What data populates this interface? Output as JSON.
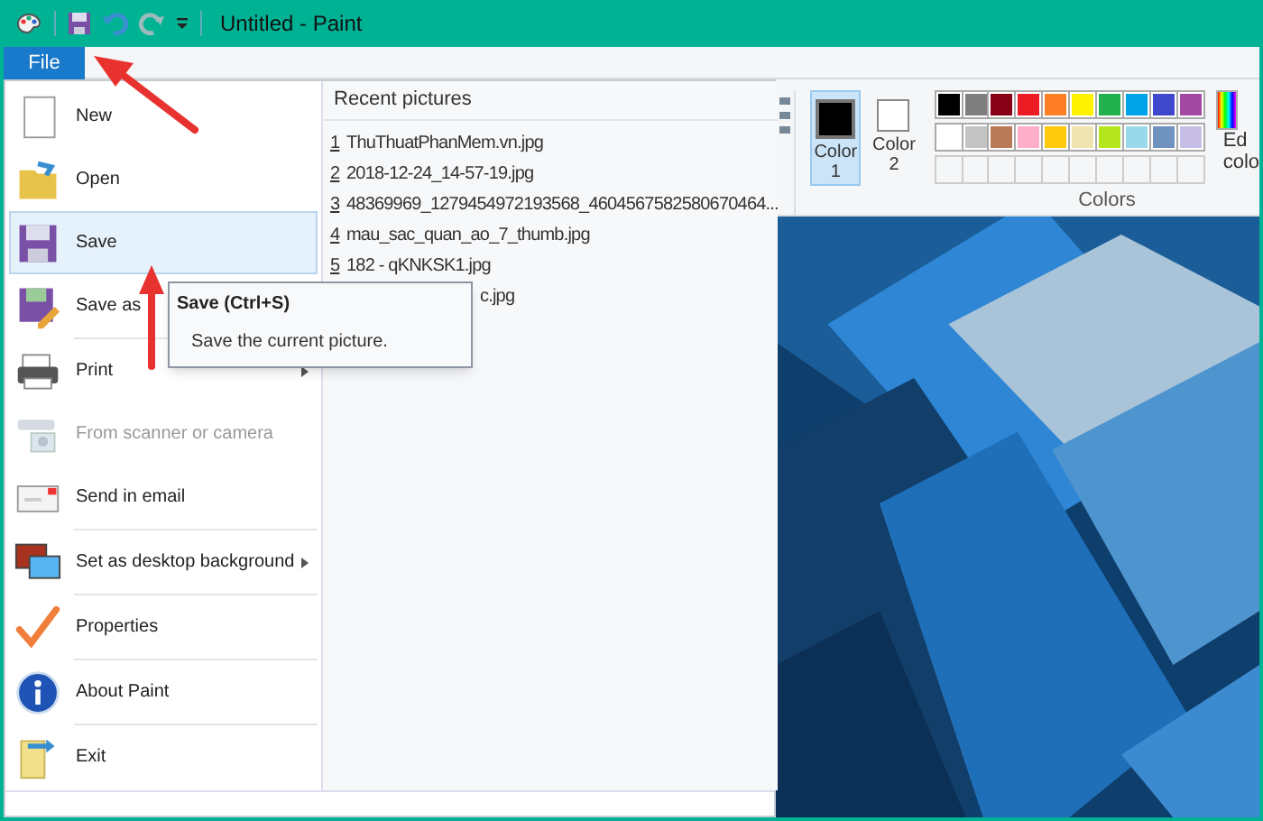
{
  "window": {
    "title": "Untitled - Paint"
  },
  "file_tab": {
    "label": "File"
  },
  "file_menu": [
    {
      "label": "New",
      "selected": false,
      "disabled": false,
      "submenu": false
    },
    {
      "label": "Open",
      "selected": false,
      "disabled": false,
      "submenu": false
    },
    {
      "label": "Save",
      "selected": true,
      "disabled": false,
      "submenu": false
    },
    {
      "label": "Save as",
      "selected": false,
      "disabled": false,
      "submenu": false
    },
    {
      "label": "Print",
      "selected": false,
      "disabled": false,
      "submenu": true
    },
    {
      "label": "From scanner or camera",
      "selected": false,
      "disabled": true,
      "submenu": false
    },
    {
      "label": "Send in email",
      "selected": false,
      "disabled": false,
      "submenu": false
    },
    {
      "label": "Set as desktop background",
      "selected": false,
      "disabled": false,
      "submenu": true
    },
    {
      "label": "Properties",
      "selected": false,
      "disabled": false,
      "submenu": false
    },
    {
      "label": "About Paint",
      "selected": false,
      "disabled": false,
      "submenu": false
    },
    {
      "label": "Exit",
      "selected": false,
      "disabled": false,
      "submenu": false
    }
  ],
  "recent_pictures": {
    "title": "Recent pictures",
    "items": [
      {
        "number": "1",
        "name": "ThuThuatPhanMem.vn.jpg"
      },
      {
        "number": "2",
        "name": "2018-12-24_14-57-19.jpg"
      },
      {
        "number": "3",
        "name": "48369969_1279454972193568_4604567582580670464..."
      },
      {
        "number": "4",
        "name": "mau_sac_quan_ao_7_thumb.jpg"
      },
      {
        "number": "5",
        "name": "182 - qKNKSK1.jpg"
      },
      {
        "name": "c.jpg"
      }
    ]
  },
  "tooltip": {
    "title": "Save (Ctrl+S)",
    "text": "Save the current picture."
  },
  "colors_group": {
    "label": "Colors",
    "color_1": {
      "label": "Color 1",
      "selected": true,
      "color": "#000000"
    },
    "color_2": {
      "label": "Color 2",
      "selected": false,
      "color": "#ffffff"
    },
    "palette": [
      {
        "color": "#000000"
      },
      {
        "color": "#7f7f7f"
      },
      {
        "color": "#880015"
      },
      {
        "color": "#ed1c24"
      },
      {
        "color": "#ff7f27"
      },
      {
        "color": "#fff200"
      },
      {
        "color": "#22b14c"
      },
      {
        "color": "#00a2e8"
      },
      {
        "color": "#3f48cc"
      },
      {
        "color": "#a349a4"
      },
      {
        "color": "#ffffff"
      },
      {
        "color": "#c3c3c3"
      },
      {
        "color": "#b97a57"
      },
      {
        "color": "#ffaec9"
      },
      {
        "color": "#ffc90e"
      },
      {
        "color": "#efe4b0"
      },
      {
        "color": "#b5e61d"
      },
      {
        "color": "#99d9ea"
      },
      {
        "color": "#7092be"
      },
      {
        "color": "#c8bfe7"
      }
    ],
    "edit_colors": [
      "Ed",
      "colo"
    ]
  }
}
